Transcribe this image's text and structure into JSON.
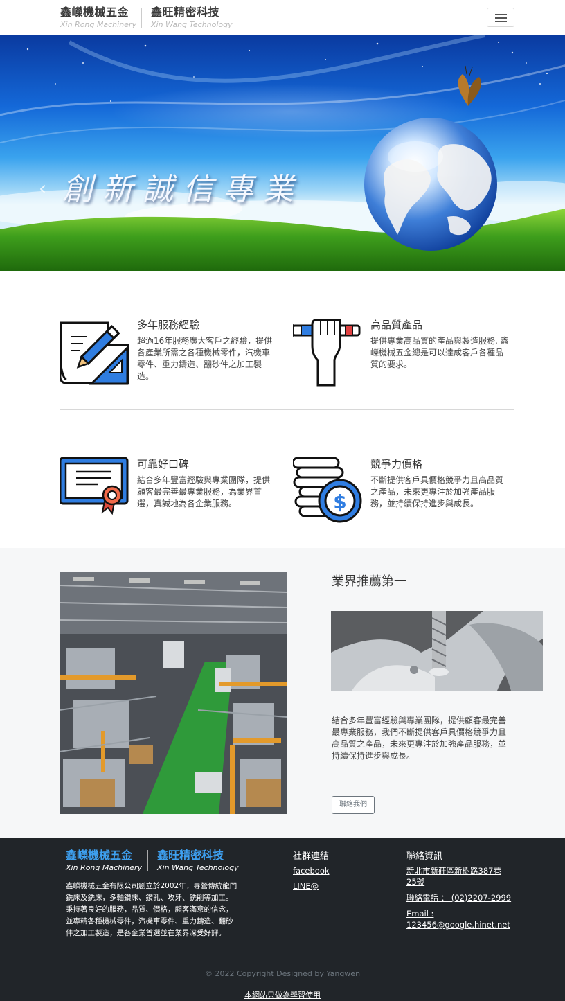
{
  "nav": {
    "brand1_zh": "鑫嶸機械五金",
    "brand1_en": "Xin Rong Machinery",
    "brand2_zh": "鑫旺精密科技",
    "brand2_en": "Xin Wang Technology",
    "menu_icon": "hamburger-menu-icon"
  },
  "hero": {
    "title": "創新誠信專業",
    "prev_icon": "chevron-left-icon",
    "slides": 3,
    "active_slide": 1
  },
  "features": [
    {
      "icon": "blueprint-pencil-icon",
      "title": "多年服務經驗",
      "text": "超過16年服務廣大客戶之經驗，提供各產業所需之各種機械零件，汽機車零件、重力鑄造、翻砂件之加工製造。"
    },
    {
      "icon": "hand-holding-pencil-icon",
      "title": "高品質產品",
      "text": "提供專業高品質的產品與製造服務, 鑫嶸機械五金總是可以達成客戶各種品質的要求。"
    },
    {
      "icon": "certificate-icon",
      "title": "可靠好口碑",
      "text": "結合多年豐富經驗與專業團隊，提供顧客最完善最專業服務，為業界首選，真誠地為各企業服務。"
    },
    {
      "icon": "coins-dollar-icon",
      "title": "競爭力價格",
      "text": "不斷提供客戶具價格競爭力且高品質之產品，未來更專注於加強產品服務，並持續保持進步與成長。"
    }
  ],
  "recommend": {
    "title": "業界推薦第一",
    "text": "結合多年豐富經驗與專業團隊，提供顧客最完善最專業服務，我們不斷提供客戶具價格競爭力且高品質之產品，未來更專注於加強產品服務，並持續保持進步與成長。",
    "button": "聯絡我們"
  },
  "footer": {
    "brand1_zh": "鑫嶸機械五金",
    "brand1_en": "Xin Rong Machinery",
    "brand2_zh": "鑫旺精密科技",
    "brand2_en": "Xin Wang Technology",
    "description": "鑫嶸機械五金有限公司創立於2002年，專營傳統龍門銑床及銑床，多軸鑽床、鑽孔、攻牙、銑削等加工。秉持著良好的服務，品質、價格，顧客滿意的信念，並專精各種機械零件，汽機車零件、重力鑄造、翻砂件之加工製造，是各企業首選並在業界深受好評。",
    "social_heading": "社群連結",
    "social_facebook": "facebook",
    "social_line": "LINE@",
    "contact_heading": "聯絡資訊",
    "address": "新北市新莊區新樹路387巷25號",
    "phone": "聯絡電話 ： (02)2207-2999",
    "email": "Email : 123456@google.hinet.net",
    "copyright": "© 2022 Copyright Designed by Yangwen",
    "notice": "本網站只做為學習使用"
  }
}
